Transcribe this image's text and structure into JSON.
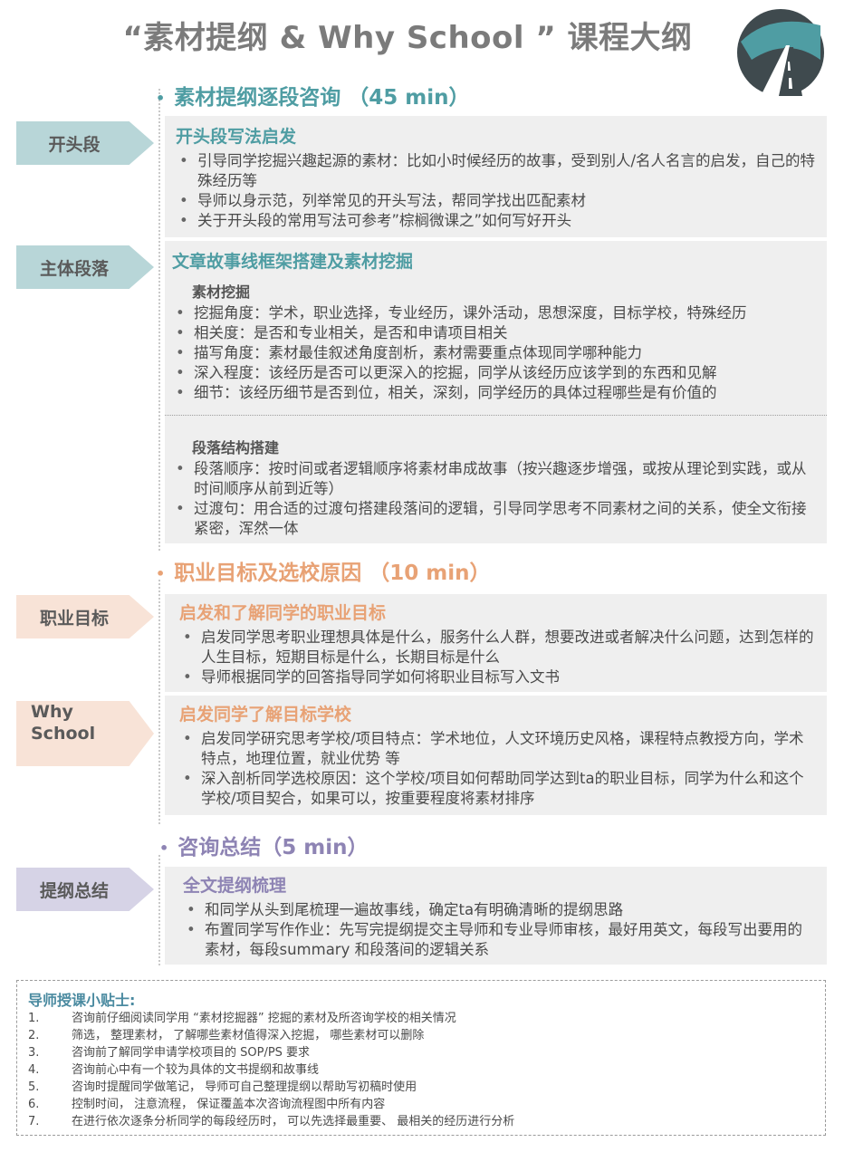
{
  "title": "“素材提纲 & Why School ” 课程大纲",
  "colors": {
    "teal": "#4f9da3",
    "orange": "#e8a275",
    "purple": "#8e84b4"
  },
  "sections": [
    {
      "heading": "素材提纲逐段咨询 （45 min）",
      "rows": [
        {
          "label": "开头段",
          "box_title": "开头段写法启发",
          "bullets": [
            "引导同学挖掘兴趣起源的素材：比如小时候经历的故事，受到别人/名人名言的启发，自己的特殊经历等",
            "导师以身示范，列举常见的开头写法，帮同学找出匹配素材",
            "关于开头段的常用写法可参考”棕榈微课之”如何写好开头"
          ]
        },
        {
          "label": "主体段落",
          "box_title": "文章故事线框架搭建及素材挖掘",
          "groups": [
            {
              "subtitle": "素材挖掘",
              "bullets": [
                "挖掘角度：学术，职业选择，专业经历，课外活动，思想深度，目标学校，特殊经历",
                "相关度：是否和专业相关，是否和申请项目相关",
                "描写角度：素材最佳叙述角度剖析，素材需要重点体现同学哪种能力",
                "深入程度：该经历是否可以更深入的挖掘，同学从该经历应该学到的东西和见解",
                "细节：该经历细节是否到位，相关，深刻，同学经历的具体过程哪些是有价值的"
              ]
            },
            {
              "subtitle": "段落结构搭建",
              "bullets": [
                "段落顺序：按时间或者逻辑顺序将素材串成故事（按兴趣逐步增强，或按从理论到实践，或从时间顺序从前到近等）",
                "过渡句：用合适的过渡句搭建段落间的逻辑，引导同学思考不同素材之间的关系，使全文衔接紧密，浑然一体"
              ]
            }
          ]
        }
      ]
    },
    {
      "heading": "职业目标及选校原因 （10 min）",
      "rows": [
        {
          "label": "职业目标",
          "box_title": "启发和了解同学的职业目标",
          "bullets": [
            "启发同学思考职业理想具体是什么，服务什么人群，想要改进或者解决什么问题，达到怎样的人生目标，短期目标是什么，长期目标是什么",
            "导师根据同学的回答指导同学如何将职业目标写入文书"
          ]
        },
        {
          "label_line1": "Why",
          "label_line2": "School",
          "box_title": "启发同学了解目标学校",
          "bullets": [
            "启发同学研究思考学校/项目特点：学术地位，人文环境历史风格，课程特点教授方向，学术特点，地理位置，就业优势 等",
            "深入剖析同学选校原因：这个学校/项目如何帮助同学达到ta的职业目标，同学为什么和这个学校/项目契合，如果可以，按重要程度将素材排序"
          ]
        }
      ]
    },
    {
      "heading": "咨询总结（5 min）",
      "rows": [
        {
          "label": "提纲总结",
          "box_title": "全文提纲梳理",
          "bullets": [
            "和同学从头到尾梳理一遍故事线，确定ta有明确清晰的提纲思路",
            "布置同学写作作业：先写完提纲提交主导师和专业导师审核，最好用英文，每段写出要用的素材，每段summary 和段落间的逻辑关系"
          ]
        }
      ]
    }
  ],
  "tips": {
    "title": "导师授课小贴士:",
    "items": [
      {
        "num": "1.",
        "text": "咨询前仔细阅读同学用 “素材挖掘器” 挖掘的素材及所咨询学校的相关情况"
      },
      {
        "num": "2.",
        "text": "筛选， 整理素材， 了解哪些素材值得深入挖掘， 哪些素材可以删除"
      },
      {
        "num": "3.",
        "text": "咨询前了解同学申请学校项目的 SOP/PS 要求"
      },
      {
        "num": "4.",
        "text": "咨询前心中有一个较为具体的文书提纲和故事线"
      },
      {
        "num": "5.",
        "text": "咨询时提醒同学做笔记， 导师可自己整理提纲以帮助写初稿时使用"
      },
      {
        "num": "6.",
        "text": "控制时间， 注意流程， 保证覆盖本次咨询流程图中所有内容"
      },
      {
        "num": "7.",
        "text": "在进行依次逐条分析同学的每段经历时， 可以先选择最重要、 最相关的经历进行分析"
      }
    ]
  },
  "logo_icon": "road-logo-icon"
}
